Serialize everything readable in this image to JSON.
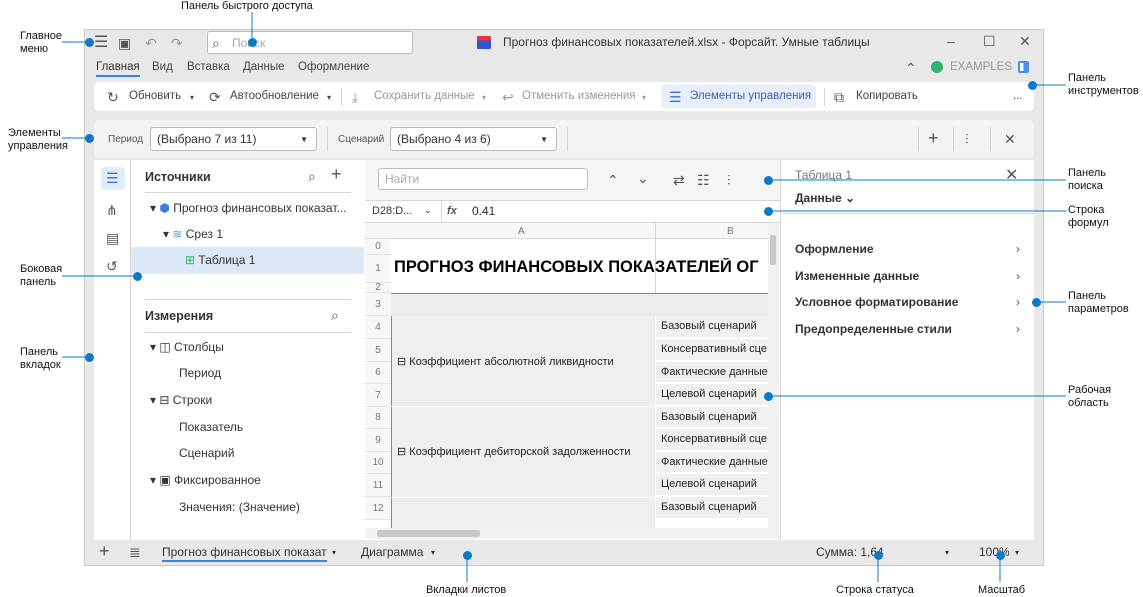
{
  "title_bar": {
    "title": "Прогноз финансовых показателей.xlsx - Форсайт. Умные таблицы",
    "search_placeholder": "Поиск"
  },
  "menu_tabs": [
    "Главная",
    "Вид",
    "Вставка",
    "Данные",
    "Оформление"
  ],
  "account": {
    "name": "EXAMPLES",
    "status_color": "#2db56d"
  },
  "toolbar": {
    "refresh": "Обновить",
    "autorefresh": "Автообновление",
    "save_data": "Сохранить данные",
    "undo_changes": "Отменить изменения",
    "controls": "Элементы управления",
    "copy": "Копировать",
    "more": "..."
  },
  "controls": {
    "period_label": "Период",
    "period_value": "(Выбрано 7 из 11)",
    "scenario_label": "Сценарий",
    "scenario_value": "(Выбрано 4 из 6)"
  },
  "sources": {
    "title": "Источники",
    "items": [
      "Прогноз финансовых показат...",
      "Срез 1",
      "Таблица 1"
    ]
  },
  "dimensions": {
    "title": "Измерения",
    "columns": "Столбцы",
    "columns_items": [
      "Период"
    ],
    "rows": "Строки",
    "rows_items": [
      "Показатель",
      "Сценарий"
    ],
    "fixed": "Фиксированное",
    "fixed_items": [
      "Значения: (Значение)"
    ]
  },
  "search_panel": {
    "placeholder": "Найти"
  },
  "formula": {
    "cell_ref": "D28:D...",
    "fx": "fx",
    "value": "0.41"
  },
  "grid": {
    "col_headers": [
      "A",
      "B"
    ],
    "row_numbers": [
      "0",
      "1",
      "2",
      "3",
      "4",
      "5",
      "6",
      "7",
      "8",
      "9",
      "10",
      "11",
      "12"
    ],
    "title": "ПРОГНОЗ ФИНАНСОВЫХ ПОКАЗАТЕЛЕЙ ОГ",
    "groups": [
      "Коэффициент абсолютной ликвидности",
      "Коэффициент дебиторской задолженности"
    ],
    "scenarios": [
      "Базовый сценарий",
      "Консервативный сце",
      "Фактические данные",
      "Целевой сценарий",
      "Базовый сценарий",
      "Консервативный сце",
      "Фактические данные",
      "Целевой сценарий",
      "Базовый сценарий"
    ]
  },
  "params": {
    "title": "Таблица 1",
    "section": "Данные",
    "items": [
      "Оформление",
      "Измененные данные",
      "Условное форматирование",
      "Предопределенные стили"
    ]
  },
  "status": {
    "sheets": [
      "Прогноз финансовых показат",
      "Диаграмма"
    ],
    "sum": "Сумма: 1,64",
    "zoom": "100%"
  },
  "callouts": {
    "main_menu": "Главное\nменю",
    "quick_access": "Панель быстрого доступа",
    "toolbar": "Панель\nинструментов",
    "controls": "Элементы\nуправления",
    "side_panel": "Боковая\nпанель",
    "tabs_panel": "Панель\nвкладок",
    "search_panel": "Панель\nпоиска",
    "formula_bar": "Строка\nформул",
    "params_panel": "Панель\nпараметров",
    "work_area": "Рабочая\nобласть",
    "sheet_tabs": "Вкладки листов",
    "status_bar": "Строка статуса",
    "zoom": "Масштаб"
  }
}
